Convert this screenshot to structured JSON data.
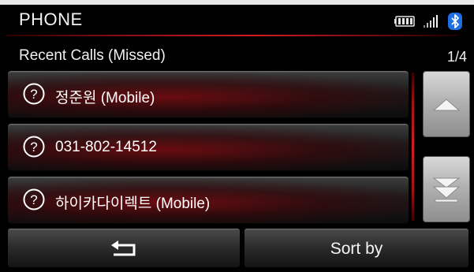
{
  "header": {
    "title": "PHONE",
    "status_icons": [
      "battery-icon",
      "signal-icon",
      "bluetooth-icon"
    ]
  },
  "list": {
    "title": "Recent Calls (Missed)",
    "page": "1/4",
    "items": [
      {
        "label": "정준원 (Mobile)",
        "icon": "unknown-caller-icon"
      },
      {
        "label": "031-802-14512",
        "icon": "unknown-caller-icon"
      },
      {
        "label": "하이카다이렉트 (Mobile)",
        "icon": "unknown-caller-icon"
      }
    ]
  },
  "scroll": {
    "up_icon": "scroll-up-icon",
    "down_icon": "scroll-page-down-icon"
  },
  "bottom_bar": {
    "back_icon": "back-arrow-icon",
    "sort_label": "Sort by"
  },
  "colors": {
    "accent_red": "#d21b22",
    "bluetooth_blue": "#1f6fe0",
    "background": "#000000",
    "text": "#ffffff"
  }
}
